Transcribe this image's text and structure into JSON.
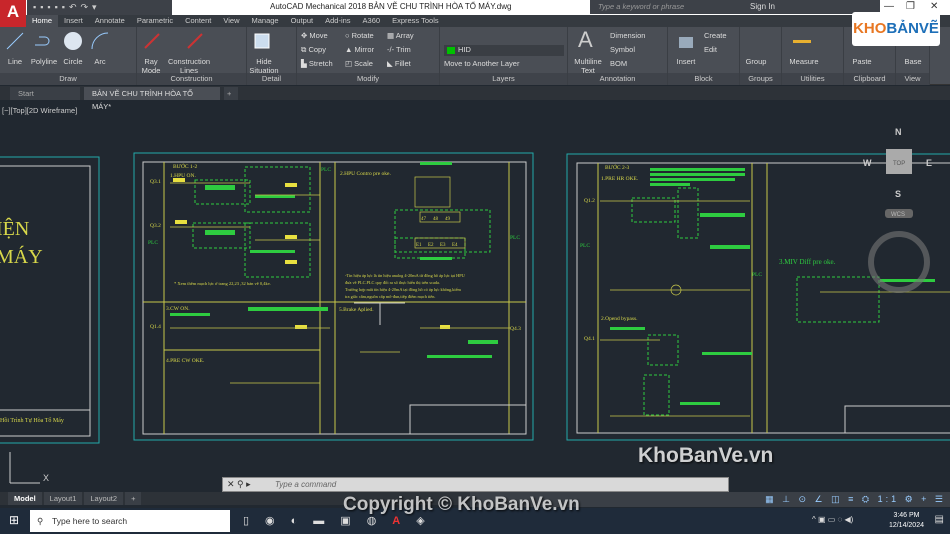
{
  "app": {
    "title": "AutoCAD Mechanical 2018   BẢN VẼ CHU TRÌNH HÒA TỔ MÁY.dwg",
    "logo_letter": "A",
    "search_placeholder": "Type a keyword or phrase",
    "sign_in": "Sign In"
  },
  "ribbon_tabs": [
    "Home",
    "Insert",
    "Annotate",
    "Parametric",
    "Content",
    "View",
    "Manage",
    "Output",
    "Add-ins",
    "A360",
    "Express Tools"
  ],
  "panels": {
    "draw": {
      "label": "Draw",
      "items": [
        "Line",
        "Polyline",
        "Circle",
        "Arc"
      ]
    },
    "construction": {
      "label": "Construction",
      "items": [
        "Ray Mode",
        "Construction Lines"
      ]
    },
    "detail": {
      "label": "Detail",
      "items": [
        "Hide Situation"
      ]
    },
    "modify": {
      "label": "Modify",
      "items": [
        "Move",
        "Rotate",
        "Array",
        "Copy",
        "Mirror",
        "Trim",
        "Stretch",
        "Scale",
        "Fillet"
      ]
    },
    "layers": {
      "label": "Layers",
      "current_layer": "HID",
      "layer_color": "#00c000",
      "move": "Move to Another Layer"
    },
    "annotation": {
      "label": "Annotation",
      "items": [
        "Multiline Text",
        "Dimension",
        "Symbol",
        "BOM"
      ]
    },
    "block": {
      "label": "Block",
      "items": [
        "Insert",
        "Create",
        "Edit"
      ]
    },
    "groups": {
      "label": "Groups",
      "items": [
        "Group"
      ]
    },
    "utilities": {
      "label": "Utilities",
      "items": [
        "Measure"
      ]
    },
    "clipboard": {
      "label": "Clipboard",
      "items": [
        "Paste"
      ]
    },
    "view": {
      "label": "View",
      "items": [
        "Base"
      ]
    }
  },
  "file_tabs": [
    "Start",
    "BẢN VẼ CHU TRÌNH HÒA TỔ MÁY*"
  ],
  "viewport_label": "[−][Top][2D Wireframe]",
  "viewcube": {
    "n": "N",
    "s": "S",
    "e": "E",
    "w": "W",
    "top": "TOP",
    "wcs": "WCS"
  },
  "drawing": {
    "left_sheet": [
      "IỆN",
      "MÁY",
      "Hồi Trình Tự Hòa Tổ Máy"
    ],
    "sheet1": {
      "step": "BƯỚC 1-2",
      "s1": "1.HPU ON.",
      "s2": "2.HPU Contro pre oke.",
      "s3": "3.CW ON.",
      "s4": "4.PRE CW OKE.",
      "s5": "5.Brake Aplied.",
      "q": [
        "Q3.1",
        "Q3.2",
        "Q1.4",
        "Q4.3"
      ],
      "plc": "PLC",
      "terminals": [
        "47",
        "48",
        "49",
        "E1",
        "E2",
        "E3",
        "E4"
      ],
      "note": "* Xem thêm mạch lực ở trang 22,23 ,32 bản vẽ 0,4kv.",
      "note2": [
        "-Tín hiệu áp lực là tín hiệu analog 4-20mA từ đồng hồ áp lực tại HPU",
        "đưa về PLC.PLC quy đổi ra số thực hiển thị trên scada.",
        "Trường hợp mất tín hiệu 4-20mA tại đồng hồ có áp lực không,kiểm",
        "tra giắc cắm,nguồn cấp mô-đun,tiếp điểm mạch tiến."
      ]
    },
    "sheet2": {
      "step": "BƯỚC 2-3",
      "s1": "1.PRE HR OKE.",
      "s2": "2.Opend bypass.",
      "s3": "3.MIV Diff pre oke.",
      "q": [
        "Q1.2",
        "Q4.1"
      ],
      "plc": "PLC"
    }
  },
  "command": {
    "placeholder": "Type a command"
  },
  "layout_tabs": [
    "Model",
    "Layout1",
    "Layout2"
  ],
  "status": {
    "scale": "1:1"
  },
  "taskbar": {
    "search": "Type here to search",
    "time": "3:46 PM",
    "date": "12/14/2024"
  },
  "watermarks": [
    "Copyright © KhoBanVe.vn",
    "KhoBanVe.vn"
  ],
  "brand_logo": "KHOBANVE"
}
